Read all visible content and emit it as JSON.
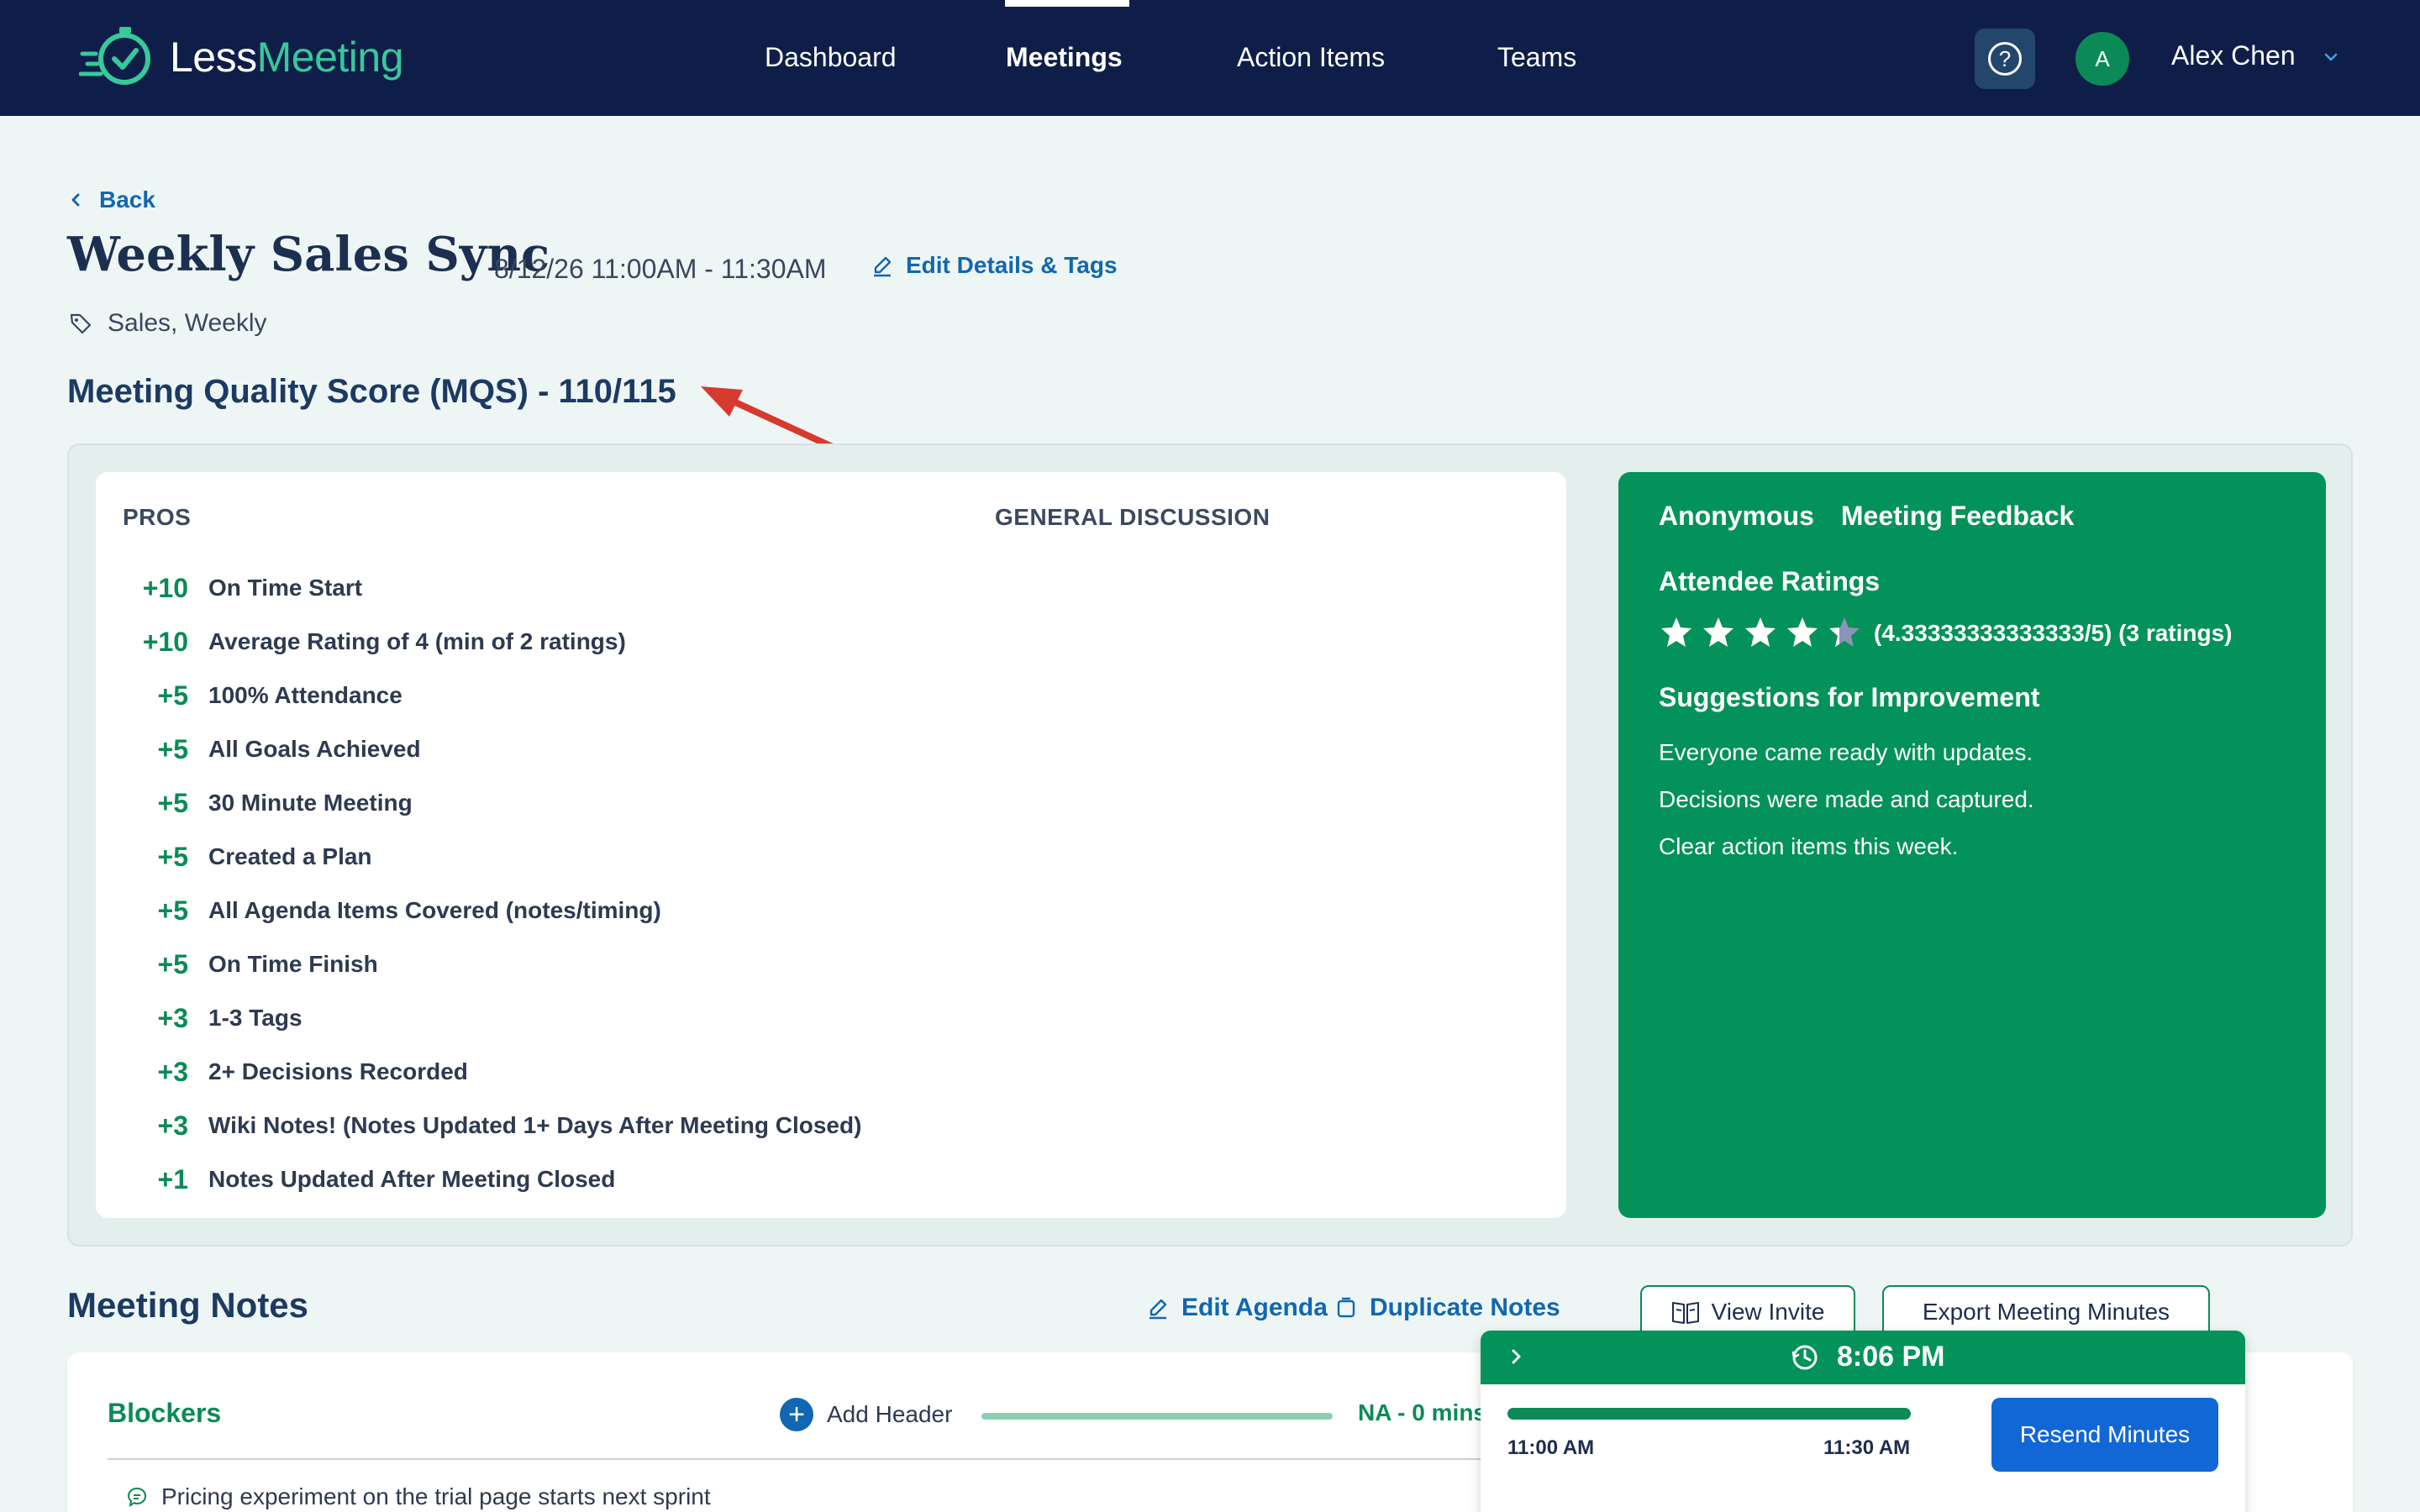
{
  "app": {
    "name_part1": "Less",
    "name_part2": "Meeting",
    "logo_icon": "clock-check-icon",
    "brand_color": "#0f1e48",
    "accent_color": "#039259"
  },
  "nav": {
    "items": [
      {
        "label": "Dashboard",
        "active": false
      },
      {
        "label": "Meetings",
        "active": true
      },
      {
        "label": "Action Items",
        "active": false
      },
      {
        "label": "Teams",
        "active": false
      }
    ],
    "help_icon": "question-circle-icon",
    "avatar_initial": "A",
    "user_name": "Alex Chen"
  },
  "meeting": {
    "back_label": "Back",
    "title": "Weekly Sales Sync",
    "datetime": "8/12/26 11:00AM - 11:30AM",
    "edit_label": "Edit Details & Tags",
    "tags": "Sales, Weekly"
  },
  "mqs": {
    "title": "Meeting Quality Score (MQS) - 110/115",
    "pros_heading": "PROS",
    "general_heading": "GENERAL DISCUSSION",
    "pros": [
      {
        "points": "+10",
        "label": "On Time Start"
      },
      {
        "points": "+10",
        "label": "Average Rating of 4 (min of 2 ratings)"
      },
      {
        "points": "+5",
        "label": "100% Attendance"
      },
      {
        "points": "+5",
        "label": "All Goals Achieved"
      },
      {
        "points": "+5",
        "label": "30 Minute Meeting"
      },
      {
        "points": "+5",
        "label": "Created a Plan"
      },
      {
        "points": "+5",
        "label": "All Agenda Items Covered (notes/timing)"
      },
      {
        "points": "+5",
        "label": "On Time Finish"
      },
      {
        "points": "+3",
        "label": "1-3 Tags"
      },
      {
        "points": "+3",
        "label": "2+ Decisions Recorded"
      },
      {
        "points": "+3",
        "label": "Wiki Notes! (Notes Updated 1+ Days After Meeting Closed)"
      },
      {
        "points": "+1",
        "label": "Notes Updated After Meeting Closed"
      }
    ]
  },
  "feedback": {
    "title_a": "Anonymous",
    "title_b": "Meeting Feedback",
    "ratings_heading": "Attendee Ratings",
    "rating_value": 4.33333333333333,
    "rating_max": 5,
    "rating_text": "(4.33333333333333/5) (3 ratings)",
    "suggestions_heading": "Suggestions for Improvement",
    "suggestions": [
      "Everyone came ready with updates.",
      "Decisions were made and captured.",
      "Clear action items this week."
    ]
  },
  "notes": {
    "title": "Meeting Notes",
    "edit_agenda": "Edit Agenda",
    "duplicate_notes": "Duplicate Notes",
    "view_invite": "View Invite",
    "export_minutes": "Export Meeting Minutes",
    "section_title": "Blockers",
    "add_header": "Add Header",
    "section_time": "NA - 0 mins",
    "item": "Pricing experiment on the trial page starts next sprint"
  },
  "timer": {
    "current_time": "8:06 PM",
    "start": "11:00 AM",
    "end": "11:30 AM",
    "progress": 1.0,
    "resend_label": "Resend Minutes"
  }
}
